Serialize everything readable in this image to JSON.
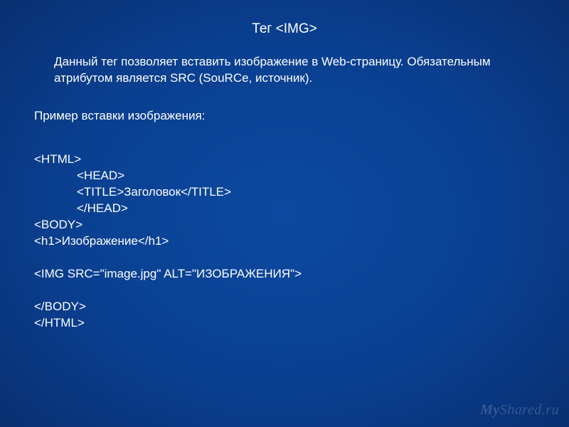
{
  "title": "Тег <IMG>",
  "description": "Данный тег позволяет вставить изображение в Web-страницу. Обязательным атрибутом является SRC (SouRCe, источник).",
  "example_label": "Пример вставки изображения:",
  "code": {
    "l1": "<HTML>",
    "l2": "<HEAD>",
    "l3": "<TITLE>Заголовок</TITLE>",
    "l4": "</HEAD>",
    "l5": "<BODY>",
    "l6": "<h1>Изображение</h1>",
    "l7": "<IMG SRC=\"image.jpg\" ALT=\"ИЗОБРАЖЕНИЯ\">",
    "l8": "</BODY>",
    "l9": "</HTML>"
  },
  "watermark_prefix": "My",
  "watermark_rest": "Shared.ru"
}
